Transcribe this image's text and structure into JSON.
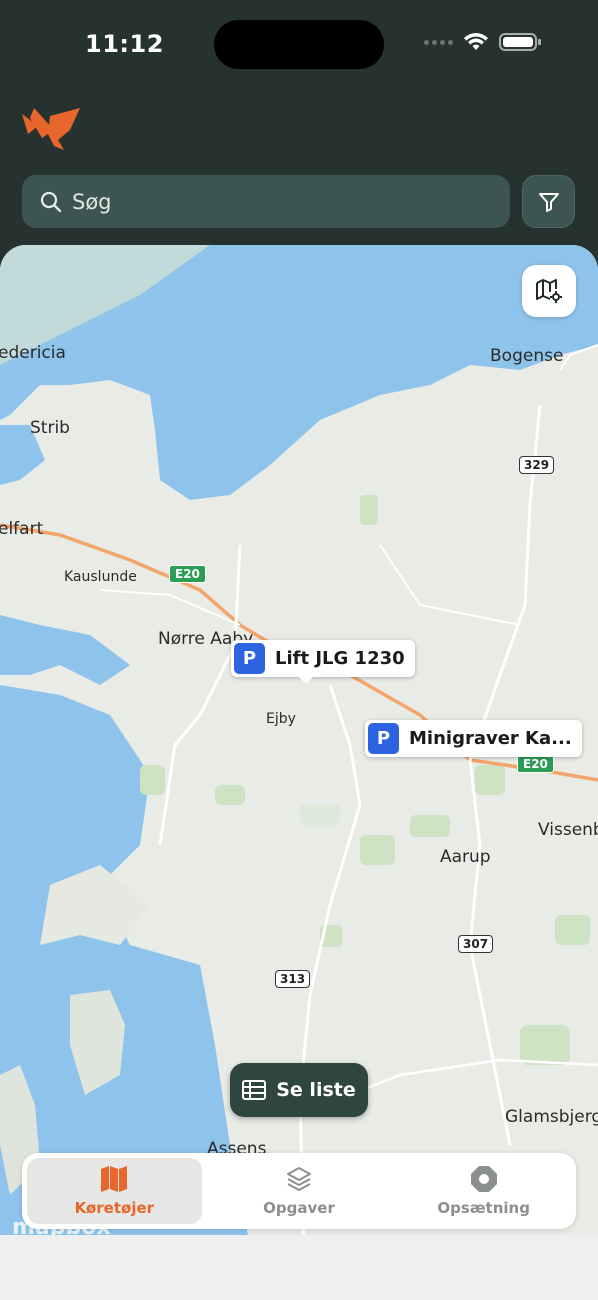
{
  "status_bar": {
    "time": "11:12"
  },
  "header": {
    "logo_icon": "bird-logo-icon",
    "search": {
      "placeholder": "Søg",
      "icon": "search-icon"
    },
    "filter_icon": "filter-icon"
  },
  "map": {
    "settings_icon": "map-settings-icon",
    "places": [
      {
        "name": "edericia"
      },
      {
        "name": "Strib"
      },
      {
        "name": "elfart"
      },
      {
        "name": "Kauslunde"
      },
      {
        "name": "Nørre Aaby"
      },
      {
        "name": "Ejby"
      },
      {
        "name": "Bogense"
      },
      {
        "name": "Vissenb"
      },
      {
        "name": "Aarup"
      },
      {
        "name": "Glamsbjerg"
      },
      {
        "name": "Assens"
      }
    ],
    "road_numbers": [
      "329",
      "307",
      "313"
    ],
    "euro_routes": [
      "E20",
      "E20"
    ],
    "markers": [
      {
        "badge": "P",
        "label": "Lift JLG 1230"
      },
      {
        "badge": "P",
        "label": "Minigraver Ka..."
      }
    ],
    "list_button": {
      "label": "Se liste",
      "icon": "list-icon"
    },
    "attribution": "mapbox"
  },
  "tabbar": {
    "tabs": [
      {
        "label": "Køretøjer",
        "icon": "map-icon",
        "active": true
      },
      {
        "label": "Opgaver",
        "icon": "layers-icon",
        "active": false
      },
      {
        "label": "Opsætning",
        "icon": "settings-octagon-icon",
        "active": false
      }
    ]
  },
  "colors": {
    "accent": "#e8662b",
    "header_bg": "#253230",
    "marker_blue": "#2d63e0",
    "water": "#8ec4ec"
  }
}
